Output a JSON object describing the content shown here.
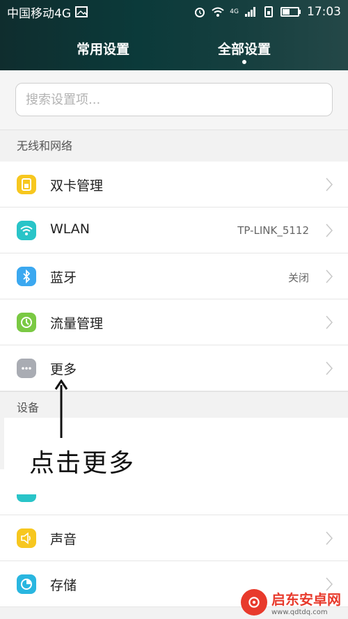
{
  "status_bar": {
    "carrier": "中国移动4G",
    "network_label": "4G",
    "time": "17:03"
  },
  "tabs": [
    {
      "label": "常用设置",
      "active": false
    },
    {
      "label": "全部设置",
      "active": true
    }
  ],
  "search": {
    "placeholder": "搜索设置项..."
  },
  "sections": [
    {
      "title": "无线和网络",
      "items": [
        {
          "label": "双卡管理",
          "value": "",
          "icon": "sim-card-icon",
          "color": "#f7c71f"
        },
        {
          "label": "WLAN",
          "value": "TP-LINK_5112",
          "icon": "wifi-icon",
          "color": "#29c4c8"
        },
        {
          "label": "蓝牙",
          "value": "关闭",
          "icon": "bluetooth-icon",
          "color": "#3ba8f0"
        },
        {
          "label": "流量管理",
          "value": "",
          "icon": "data-usage-icon",
          "color": "#7ac943"
        },
        {
          "label": "更多",
          "value": "",
          "icon": "more-icon",
          "color": "#a9acb3"
        }
      ]
    },
    {
      "title": "设备",
      "items": [
        {
          "label": "声音",
          "value": "",
          "icon": "sound-icon",
          "color": "#f7c71f"
        },
        {
          "label": "存储",
          "value": "",
          "icon": "storage-icon",
          "color": "#29b6e0"
        }
      ]
    }
  ],
  "annotation": {
    "text": "点击更多"
  },
  "watermark": {
    "title": "启东安卓网",
    "url": "www.qdtdq.com"
  },
  "colors": {
    "header": "#0b3a3a",
    "accent": "#e83a2c"
  }
}
